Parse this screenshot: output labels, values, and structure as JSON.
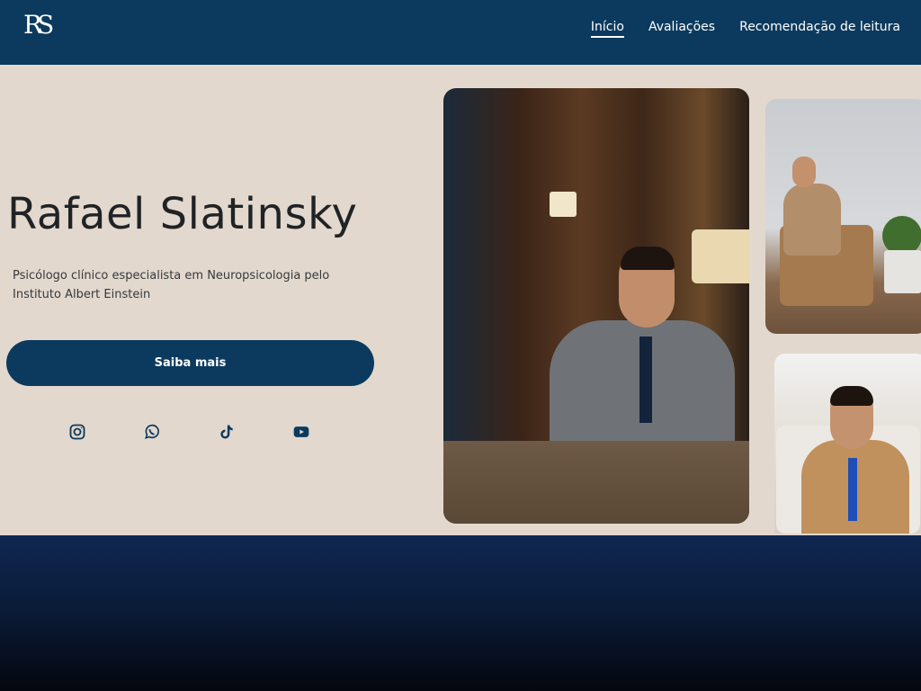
{
  "header": {
    "logo": "RS",
    "nav": [
      {
        "label": "Início",
        "active": true
      },
      {
        "label": "Avaliações",
        "active": false
      },
      {
        "label": "Recomendação de leitura",
        "active": false
      }
    ]
  },
  "hero": {
    "name": "Rafael Slatinsky",
    "description": "Psicólogo clínico especialista em Neuropsicologia pelo Instituto Albert Einstein",
    "cta_label": "Saiba mais",
    "socials": [
      {
        "icon": "instagram-icon"
      },
      {
        "icon": "whatsapp-icon"
      },
      {
        "icon": "tiktok-icon"
      },
      {
        "icon": "youtube-icon"
      }
    ]
  },
  "colors": {
    "primary": "#0b3a5e",
    "background": "#e3d8cd",
    "text": "#1f2326"
  }
}
